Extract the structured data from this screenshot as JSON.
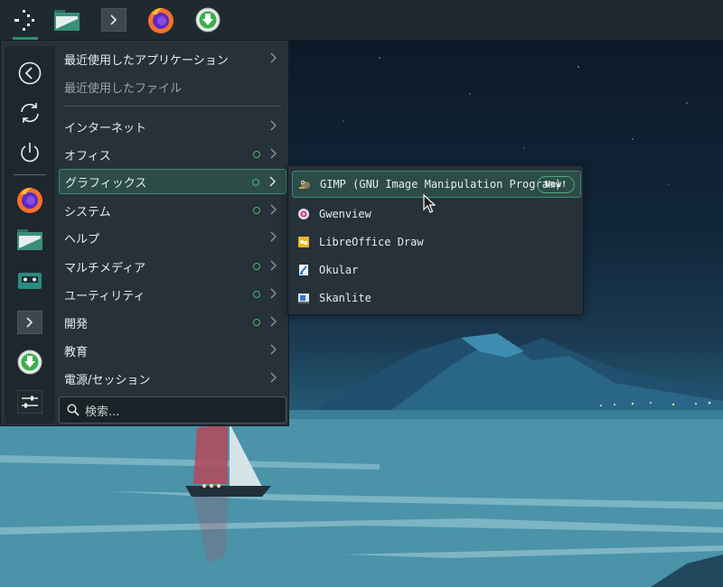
{
  "taskbar": {
    "items": [
      {
        "name": "application-launcher",
        "icon": "launcher-icon"
      },
      {
        "name": "file-manager",
        "icon": "folder-icon"
      },
      {
        "name": "terminal",
        "icon": "terminal-icon"
      },
      {
        "name": "firefox",
        "icon": "firefox-icon"
      },
      {
        "name": "software-updater",
        "icon": "download-icon"
      }
    ]
  },
  "favorites": {
    "actions": [
      {
        "name": "back",
        "icon": "back-circle-icon"
      },
      {
        "name": "refresh",
        "icon": "refresh-icon"
      },
      {
        "name": "power",
        "icon": "power-icon"
      }
    ],
    "apps": [
      {
        "name": "firefox",
        "icon": "firefox-icon"
      },
      {
        "name": "file-manager",
        "icon": "folder-icon"
      },
      {
        "name": "cassette-player",
        "icon": "cassette-icon"
      },
      {
        "name": "terminal",
        "icon": "terminal-icon"
      },
      {
        "name": "software-updater",
        "icon": "download-icon"
      },
      {
        "name": "settings",
        "icon": "settings-icon"
      }
    ]
  },
  "categories": {
    "recent_apps": "最近使用したアプリケーション",
    "recent_files": "最近使用したファイル",
    "internet": "インターネット",
    "office": "オフィス",
    "graphics": "グラフィックス",
    "system": "システム",
    "help": "ヘルプ",
    "multimedia": "マルチメディア",
    "utilities": "ユーティリティ",
    "development": "開発",
    "education": "教育",
    "power_session": "電源/セッション"
  },
  "search": {
    "placeholder": "検索..."
  },
  "submenu": {
    "items": [
      {
        "label": "GIMP (GNU Image Manipulation Program)",
        "badge": "New!",
        "icon": "gimp-icon"
      },
      {
        "label": "Gwenview",
        "icon": "gwenview-icon"
      },
      {
        "label": "LibreOffice Draw",
        "icon": "libreoffice-draw-icon"
      },
      {
        "label": "Okular",
        "icon": "okular-icon"
      },
      {
        "label": "Skanlite",
        "icon": "skanlite-icon"
      }
    ]
  },
  "colors": {
    "accent": "#3c8a72",
    "new_dot": "#3fbf6f",
    "panel": "#26313a"
  }
}
